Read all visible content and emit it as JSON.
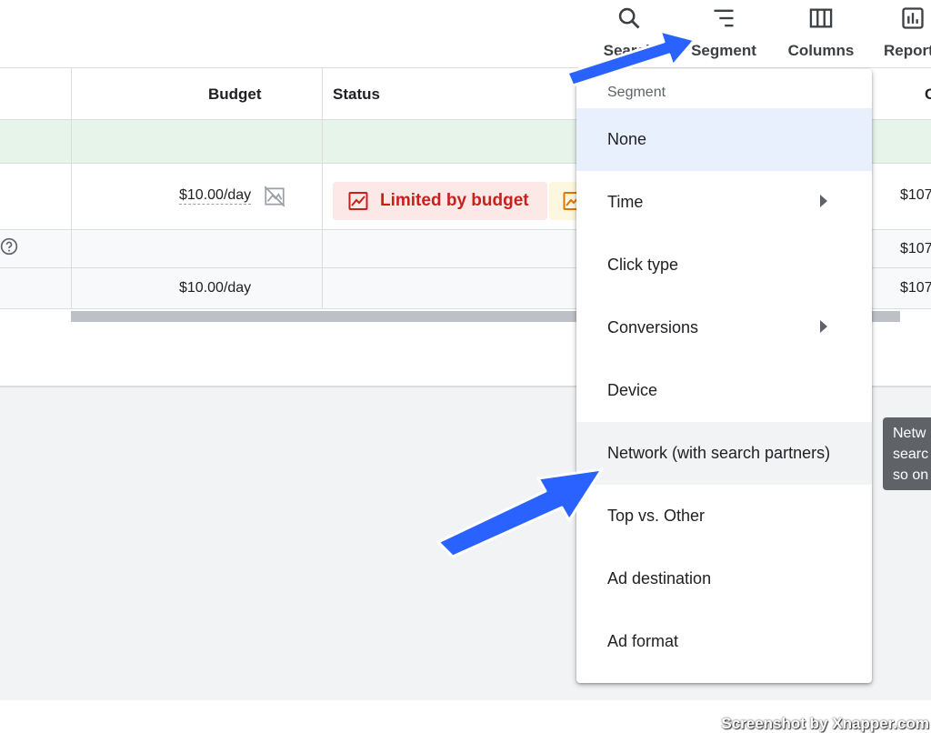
{
  "toolbar": {
    "search_label": "Search",
    "segment_label": "Segment",
    "columns_label": "Columns",
    "reports_label": "Reports"
  },
  "table": {
    "header_budget": "Budget",
    "header_status": "Status",
    "header_cost_partial": "C",
    "row1_budget": "$10.00/day",
    "row1_status": "Limited by budget",
    "row1_cost": "$107",
    "row2_cost": "$107",
    "row3_budget": "$10.00/day",
    "row3_cost": "$107"
  },
  "menu": {
    "title": "Segment",
    "items": [
      {
        "label": "None",
        "selected": true,
        "submenu": false
      },
      {
        "label": "Time",
        "submenu": true
      },
      {
        "label": "Click type",
        "submenu": false
      },
      {
        "label": "Conversions",
        "submenu": true
      },
      {
        "label": "Device",
        "submenu": false
      },
      {
        "label": "Network (with search partners)",
        "submenu": false,
        "hover": true
      },
      {
        "label": "Top vs. Other",
        "submenu": false
      },
      {
        "label": "Ad destination",
        "submenu": false
      },
      {
        "label": "Ad format",
        "submenu": false
      }
    ]
  },
  "tooltip": {
    "line1": "Netw",
    "line2": "searc",
    "line3": "so on"
  },
  "watermark": "Screenshot by Xnapper.com",
  "colors": {
    "arrow": "#2962ff",
    "selected_item": "#e8f0fe",
    "limited_badge_bg": "#fce8e6",
    "limited_badge_text": "#c5221f",
    "total_row": "#e6f4ea"
  }
}
